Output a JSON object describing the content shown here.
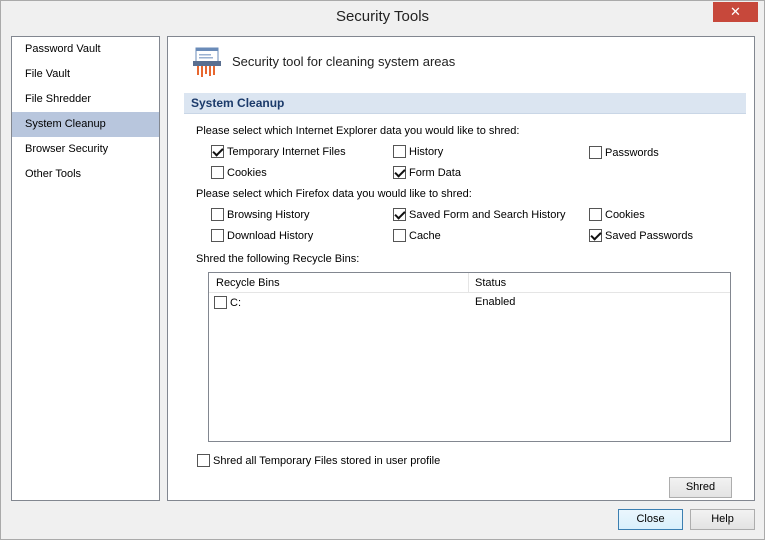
{
  "window": {
    "title": "Security Tools"
  },
  "sidebar": {
    "items": [
      {
        "label": "Password Vault"
      },
      {
        "label": "File Vault"
      },
      {
        "label": "File Shredder"
      },
      {
        "label": "System Cleanup",
        "selected": true
      },
      {
        "label": "Browser Security"
      },
      {
        "label": "Other Tools"
      }
    ]
  },
  "header": {
    "text": "Security tool for cleaning system areas",
    "icon": "shredder-icon"
  },
  "section": {
    "title": "System Cleanup"
  },
  "ie": {
    "prompt": "Please select which Internet Explorer data you would like to shred:",
    "options": [
      {
        "label": "Temporary Internet Files",
        "checked": true
      },
      {
        "label": "History",
        "checked": false
      },
      {
        "label": "Passwords",
        "checked": false
      },
      {
        "label": "Cookies",
        "checked": false
      },
      {
        "label": "Form Data",
        "checked": true
      }
    ]
  },
  "firefox": {
    "prompt": "Please select which Firefox data you would like to shred:",
    "options": [
      {
        "label": "Browsing History",
        "checked": false
      },
      {
        "label": "Saved Form and Search History",
        "checked": true
      },
      {
        "label": "Cookies",
        "checked": false
      },
      {
        "label": "Download History",
        "checked": false
      },
      {
        "label": "Cache",
        "checked": false
      },
      {
        "label": "Saved Passwords",
        "checked": true
      }
    ]
  },
  "recycle": {
    "prompt": "Shred the following Recycle Bins:",
    "columns": [
      "Recycle Bins",
      "Status"
    ],
    "rows": [
      {
        "name": "C:",
        "status": "Enabled",
        "checked": false
      }
    ]
  },
  "temp_files": {
    "label": "Shred all Temporary Files stored in user profile",
    "checked": false
  },
  "buttons": {
    "shred": "Shred",
    "close": "Close",
    "help": "Help"
  },
  "colors": {
    "selected_bg": "#b8c6dd",
    "section_bg": "#dbe5f1",
    "close_button": "#c7483b"
  }
}
